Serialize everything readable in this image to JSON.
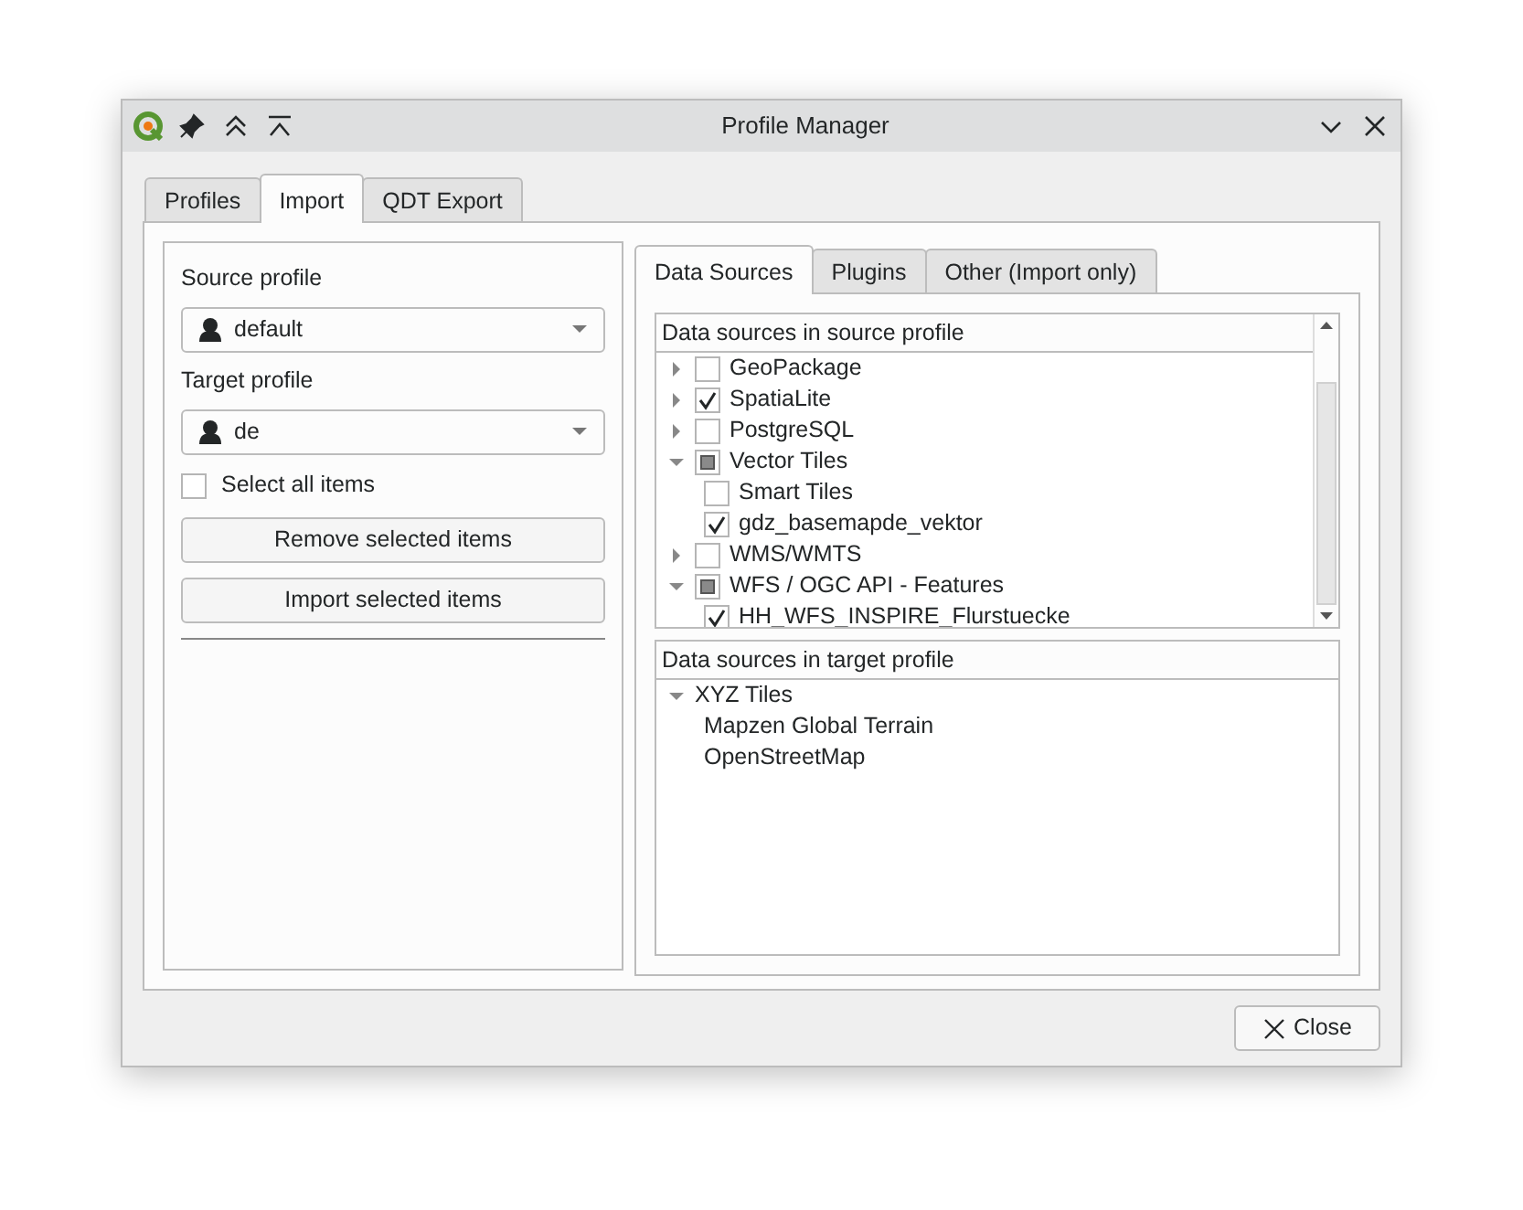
{
  "window": {
    "title": "Profile Manager"
  },
  "tabs": [
    {
      "label": "Profiles",
      "selected": false
    },
    {
      "label": "Import",
      "selected": true
    },
    {
      "label": "QDT Export",
      "selected": false
    }
  ],
  "source_profile": {
    "label": "Source profile",
    "value": "default"
  },
  "target_profile": {
    "label": "Target profile",
    "value": "de"
  },
  "select_all": {
    "label": "Select all items",
    "checked": false
  },
  "buttons": [
    "Remove selected items",
    "Import selected items"
  ],
  "sub_tabs": [
    {
      "label": "Data Sources",
      "selected": true
    },
    {
      "label": "Plugins",
      "selected": false
    },
    {
      "label": "Other (Import only)",
      "selected": false
    }
  ],
  "source_tree": {
    "header": "Data sources in source profile",
    "items": [
      {
        "label": "GeoPackage",
        "checked": false,
        "partial": false,
        "expanded": false
      },
      {
        "label": "SpatiaLite",
        "checked": true,
        "partial": false,
        "expanded": false
      },
      {
        "label": "PostgreSQL",
        "checked": false,
        "partial": false,
        "expanded": false
      },
      {
        "label": "Vector Tiles",
        "checked": false,
        "partial": true,
        "expanded": true,
        "children": [
          {
            "label": "Smart Tiles",
            "checked": false,
            "partial": false
          },
          {
            "label": "gdz_basemapde_vektor",
            "checked": true,
            "partial": false
          }
        ]
      },
      {
        "label": "WMS/WMTS",
        "checked": false,
        "partial": false,
        "expanded": false
      },
      {
        "label": "WFS / OGC API - Features",
        "checked": false,
        "partial": true,
        "expanded": true,
        "children": [
          {
            "label": "HH_WFS_INSPIRE_Flurstuecke",
            "checked": true,
            "partial": false
          }
        ]
      }
    ]
  },
  "target_tree": {
    "header": "Data sources in target profile",
    "items": [
      {
        "label": "XYZ Tiles",
        "expanded": true,
        "children": [
          {
            "label": "Mapzen Global Terrain"
          },
          {
            "label": "OpenStreetMap"
          }
        ]
      }
    ]
  },
  "close_button": {
    "label": "Close"
  }
}
